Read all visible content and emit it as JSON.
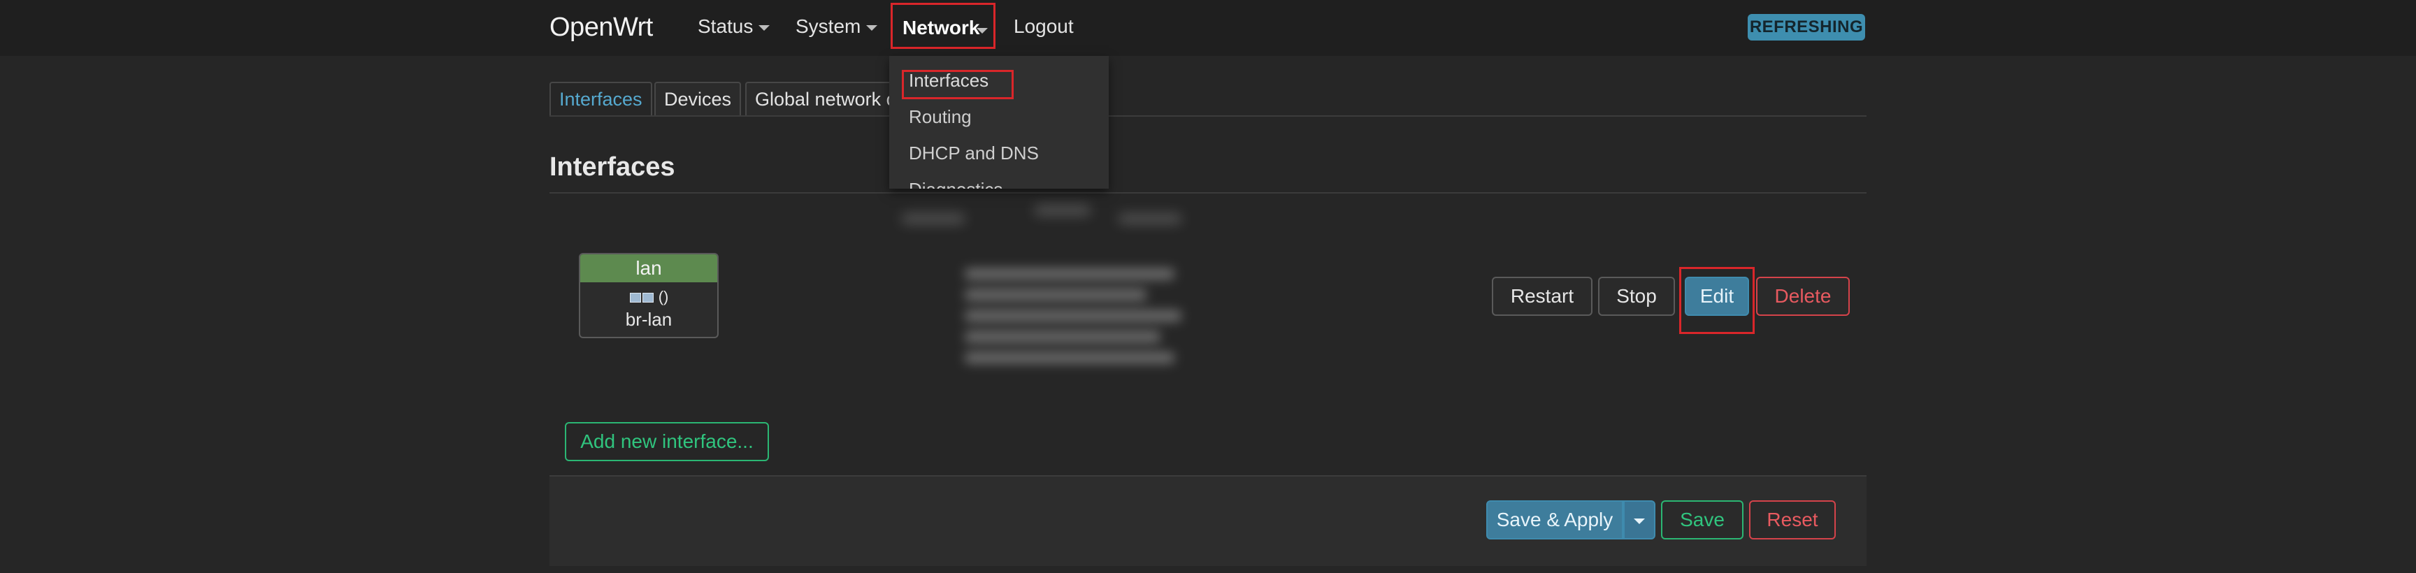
{
  "header": {
    "brand": "OpenWrt",
    "nav": {
      "status": "Status",
      "system": "System",
      "network": "Network",
      "logout": "Logout"
    },
    "badge": "REFRESHING"
  },
  "network_menu": {
    "items": [
      "Interfaces",
      "Routing",
      "DHCP and DNS",
      "Diagnostics"
    ]
  },
  "tabs": [
    "Interfaces",
    "Devices",
    "Global network o"
  ],
  "section": {
    "title": "Interfaces"
  },
  "interface": {
    "name": "lan",
    "icon_text": "()",
    "device": "br-lan"
  },
  "actions": {
    "restart": "Restart",
    "stop": "Stop",
    "edit": "Edit",
    "delete": "Delete"
  },
  "add_interface": "Add new interface...",
  "footer": {
    "save_apply": "Save & Apply",
    "save": "Save",
    "reset": "Reset"
  },
  "colors": {
    "accent": "#3e7d9c",
    "success": "#2bb673",
    "danger": "#d4434a",
    "highlight": "#d9262a",
    "iface_head": "#5d8a4f"
  }
}
